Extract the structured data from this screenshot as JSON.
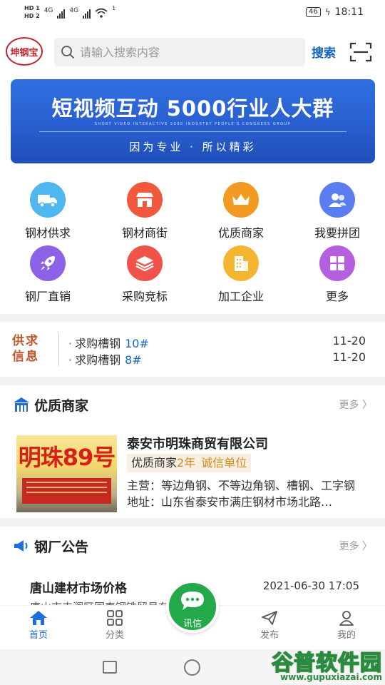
{
  "status_bar": {
    "hd1": "HD 1",
    "hd2": "HD 2",
    "net1": "4G",
    "net2": "4G",
    "wifi_badge": "1",
    "battery": "46",
    "time": "18:11"
  },
  "header": {
    "logo_text": "坤钢宝",
    "search_placeholder": "请输入搜索内容",
    "search_button": "搜索"
  },
  "banner": {
    "title": "短视频互动 5000行业人大群",
    "subtitle_en": "SHORT VIDEO INTERACTIVE 5000 INDUSTRY PEOPLE'S CONGRESS GROUP",
    "tagline": "因为专业 · 所以精彩"
  },
  "grid_menu": [
    {
      "label": "钢材供求",
      "icon": "truck-icon",
      "color": "#4fb6f0"
    },
    {
      "label": "钢材商街",
      "icon": "storefront-icon",
      "color": "#f2583e"
    },
    {
      "label": "优质商家",
      "icon": "crown-icon",
      "color": "#f39a23"
    },
    {
      "label": "我要拼团",
      "icon": "group-icon",
      "color": "#5a7ef2"
    },
    {
      "label": "钢厂直销",
      "icon": "rocket-icon",
      "color": "#8c63e6"
    },
    {
      "label": "采购竞标",
      "icon": "layers-icon",
      "color": "#f0534a"
    },
    {
      "label": "加工企业",
      "icon": "building-icon",
      "color": "#f4b531"
    },
    {
      "label": "更多",
      "icon": "grid-icon",
      "color": "#b45ee0"
    }
  ],
  "supply_info": {
    "tag_line1": "供求",
    "tag_line2": "信息",
    "items": [
      {
        "text": "求购槽钢",
        "code": "10#",
        "date": "11-20"
      },
      {
        "text": "求购槽钢",
        "code": "8#",
        "date": "11-20"
      }
    ]
  },
  "merchants": {
    "title": "优质商家",
    "more": "更多",
    "image_text": "明珠89号",
    "name": "泰安市明珠商贸有限公司",
    "tag_type": "优质商家",
    "tag_years": "2年",
    "tag_credit": "诚信单位",
    "main_business": "主营：等边角钢、不等边角钢、槽钢、工字钢",
    "address": "地址：山东省泰安市满庄钢材市场北路…"
  },
  "notices": {
    "title": "钢厂公告",
    "more": "更多",
    "item_title": "唐山建材市场价格",
    "item_date": "2021-06-30 17:05",
    "item_sub": "唐山市丰润区国泰钢铁贸易有限公司"
  },
  "bottom_nav": {
    "home": "首页",
    "category": "分类",
    "message": "讯信",
    "publish": "发布",
    "mine": "我的"
  },
  "watermark": {
    "title": "谷普软件园",
    "url": "www.gupuxiazai.com"
  },
  "colors": {
    "accent_blue": "#1e6fd9",
    "fab_green": "#23a84a",
    "supply_tag": "#c0552b"
  }
}
